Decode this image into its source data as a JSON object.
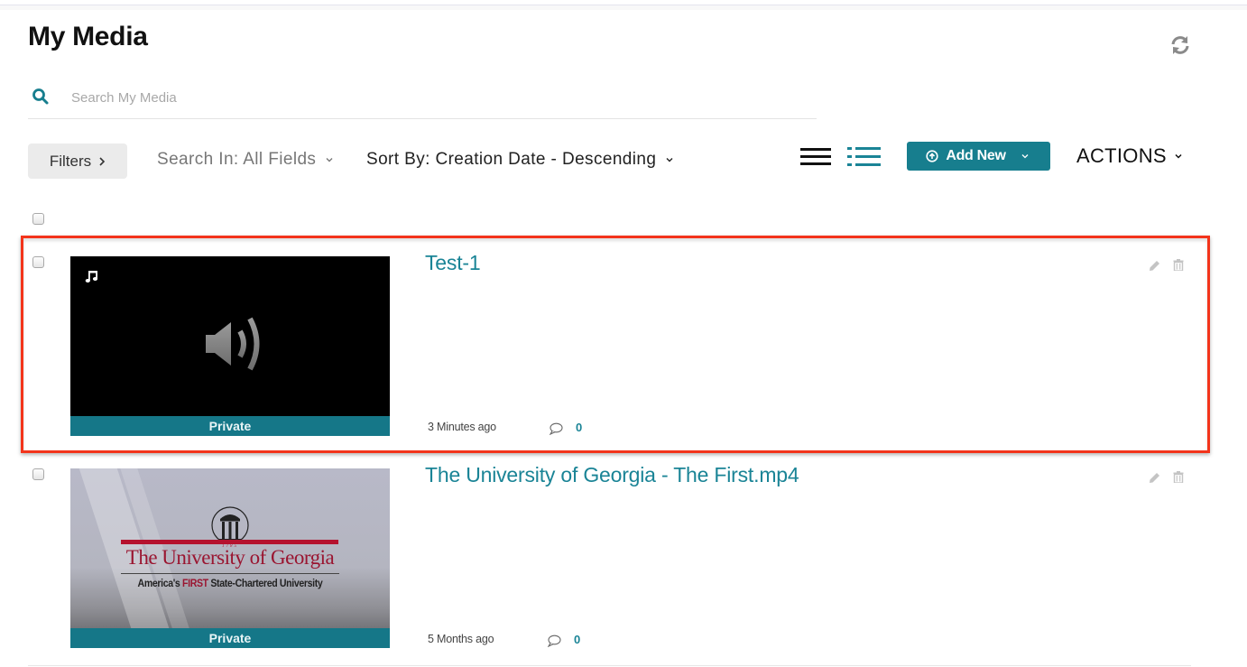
{
  "page": {
    "title": "My Media",
    "refresh_icon": "refresh-icon"
  },
  "search": {
    "placeholder": "Search My Media",
    "value": "",
    "icon": "search-icon"
  },
  "toolbar": {
    "filters_label": "Filters",
    "search_in_label": "Search In: All Fields",
    "sort_by_label": "Sort By: Creation Date - Descending",
    "view_list_icon": "list-view-icon",
    "view_details_icon": "detailed-view-icon",
    "add_new_label": "Add New",
    "actions_label": "ACTIONS",
    "colors": {
      "accent": "#177e8e",
      "filters_bg": "#ebebeb"
    }
  },
  "media": [
    {
      "title": "Test-1",
      "type": "audio",
      "privacy": "Private",
      "time": "3 Minutes ago",
      "comments": "0",
      "selected": false,
      "highlighted": true
    },
    {
      "title": "The University of Georgia - The First.mp4",
      "type": "video",
      "privacy": "Private",
      "time": "5 Months ago",
      "comments": "0",
      "selected": false,
      "highlighted": false,
      "thumbnail_text": {
        "year": "1785",
        "line1": "The University of Georgia",
        "line2_pre": "America's ",
        "line2_bold": "FIRST",
        "line2_post": " State-Chartered University"
      }
    }
  ],
  "highlight_color": "#f3341b"
}
